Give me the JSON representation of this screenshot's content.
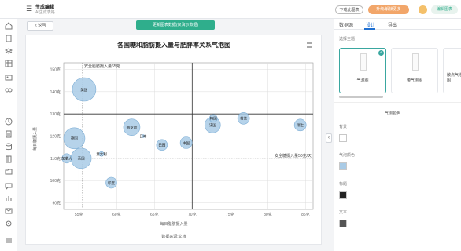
{
  "app": {
    "menu_icon": "hamburger-icon",
    "title": "生成编辑",
    "subtitle": "AI生成表格",
    "btn_download": "下载此图表",
    "btn_upgrade": "升级/解锁更多",
    "btn_user": "编辑图表"
  },
  "toolbar": {
    "back": "< 返回",
    "banner": "更新图表数据(仅演示数据)"
  },
  "chart_data": {
    "type": "scatter",
    "title": "各国糖和脂肪摄入量与肥胖率关系气泡图",
    "xlabel": "每日脂肪摄入量",
    "ylabel": "每日糖摄入量",
    "source": "数据来源:文档",
    "x_ticks": [
      "55克",
      "60克",
      "65克",
      "70克",
      "75克",
      "80克",
      "85克"
    ],
    "y_ticks": [
      "150克",
      "140克",
      "130克",
      "120克",
      "110克",
      "100克",
      "90克"
    ],
    "xlim": [
      53,
      86
    ],
    "ylim": [
      87,
      153
    ],
    "ref_x": 55.5,
    "ref_x_label": "安全脂肪摄入量65克",
    "ref_y": 110,
    "ref_y_label": "安全糖摄入量50克/天",
    "points": [
      {
        "x": 55.7,
        "y": 141,
        "size": 15,
        "name": "美国"
      },
      {
        "x": 54.4,
        "y": 119,
        "size": 13.5,
        "name": "德国"
      },
      {
        "x": 55.3,
        "y": 110,
        "size": 13,
        "name": "英国"
      },
      {
        "x": 53.4,
        "y": 110,
        "size": 6,
        "name": "加拿大"
      },
      {
        "x": 58.0,
        "y": 112,
        "size": 3,
        "name": "意大利"
      },
      {
        "x": 62.0,
        "y": 124,
        "size": 10.5,
        "name": "俄罗斯"
      },
      {
        "x": 63.5,
        "y": 120,
        "size": 2,
        "name": "日本"
      },
      {
        "x": 66.0,
        "y": 116,
        "size": 7,
        "name": "巴西"
      },
      {
        "x": 69.2,
        "y": 117,
        "size": 7.5,
        "name": "中国"
      },
      {
        "x": 72.7,
        "y": 125,
        "size": 10,
        "name": "法国"
      },
      {
        "x": 72.8,
        "y": 128,
        "size": 5,
        "name": "韩国"
      },
      {
        "x": 76.8,
        "y": 128,
        "size": 7.5,
        "name": "荷兰"
      },
      {
        "x": 84.3,
        "y": 125,
        "size": 7.5,
        "name": "瑞士"
      },
      {
        "x": 59.3,
        "y": 99,
        "size": 7,
        "name": "印度"
      }
    ],
    "bubble_color": "#a9cbe6",
    "bubble_stroke": "#7fafd6",
    "grid": true
  },
  "panel": {
    "tabs": [
      "数据源",
      "设计",
      "导出"
    ],
    "active_tab": 1,
    "chart_style_label": "选择主题",
    "thumbs": [
      "气泡图",
      "带气泡图",
      "散点气泡图"
    ],
    "section": "气泡颜色",
    "color_items": [
      {
        "label": "背景",
        "color": "#ffffff"
      },
      {
        "label": "气泡颜色",
        "color": "#a9cbe6"
      },
      {
        "label": "标题",
        "color": "#222222"
      },
      {
        "label": "文本",
        "color": "#555555"
      }
    ]
  }
}
